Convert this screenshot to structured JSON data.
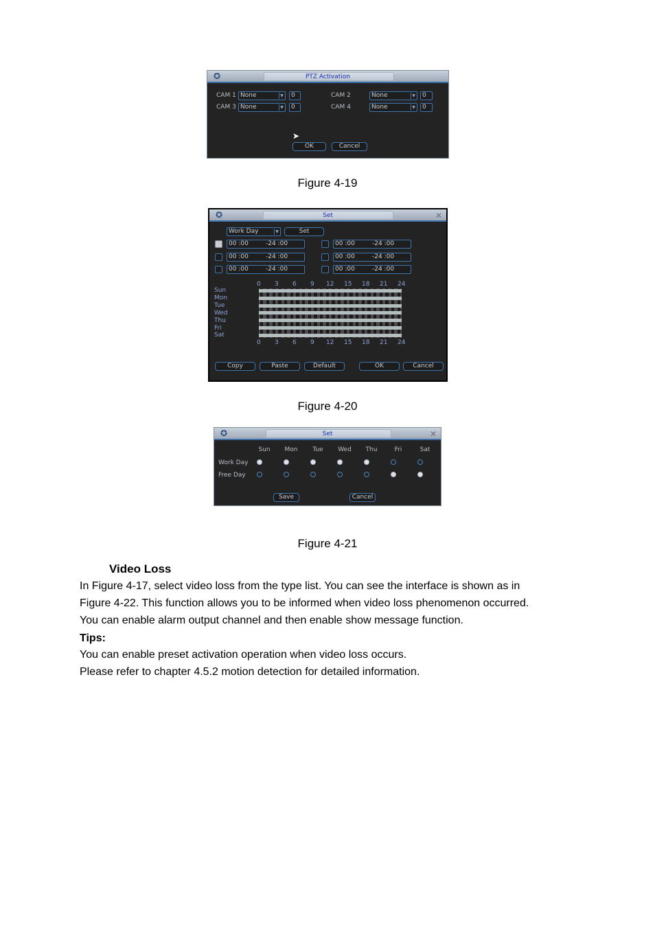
{
  "fig19": {
    "title": "PTZ Activation",
    "cams": [
      {
        "label": "CAM 1",
        "type": "None",
        "value": "0"
      },
      {
        "label": "CAM 2",
        "type": "None",
        "value": "0"
      },
      {
        "label": "CAM 3",
        "type": "None",
        "value": "0"
      },
      {
        "label": "CAM 4",
        "type": "None",
        "value": "0"
      }
    ],
    "ok": "OK",
    "cancel": "Cancel",
    "caption": "Figure 4-19"
  },
  "fig20": {
    "title": "Set",
    "day_type": "Work Day",
    "set_btn": "Set",
    "periods": [
      {
        "start": "00 :00",
        "end": "-24 :00",
        "checked": true
      },
      {
        "start": "00 :00",
        "end": "-24 :00",
        "checked": false
      },
      {
        "start": "00 :00",
        "end": "-24 :00",
        "checked": false
      },
      {
        "start": "00 :00",
        "end": "-24 :00",
        "checked": false
      },
      {
        "start": "00 :00",
        "end": "-24 :00",
        "checked": false
      },
      {
        "start": "00 :00",
        "end": "-24 :00",
        "checked": false
      }
    ],
    "hours": [
      "0",
      "3",
      "6",
      "9",
      "12",
      "15",
      "18",
      "21",
      "24"
    ],
    "days": [
      "Sun",
      "Mon",
      "Tue",
      "Wed",
      "Thu",
      "Fri",
      "Sat"
    ],
    "buttons": {
      "copy": "Copy",
      "paste": "Paste",
      "default": "Default",
      "ok": "OK",
      "cancel": "Cancel"
    },
    "caption": "Figure 4-20"
  },
  "fig21": {
    "title": "Set",
    "days": [
      "Sun",
      "Mon",
      "Tue",
      "Wed",
      "Thu",
      "Fri",
      "Sat"
    ],
    "rows": [
      {
        "label": "Work Day",
        "selected": [
          true,
          true,
          true,
          true,
          true,
          false,
          false
        ]
      },
      {
        "label": "Free Day",
        "selected": [
          false,
          false,
          false,
          false,
          false,
          true,
          true
        ]
      }
    ],
    "save": "Save",
    "cancel": "Cancel",
    "caption": "Figure 4-21"
  },
  "section": {
    "heading": "Video Loss",
    "para": [
      "In Figure 4-17, select video loss from the type list. You can see the interface is shown as in",
      "Figure 4-22. This function allows you to be informed when video loss phenomenon occurred.",
      "You can enable alarm output channel and then enable show message function."
    ],
    "tips_label": "Tips:",
    "tips": [
      "You can enable preset activation operation when video loss occurs.",
      "Please refer to chapter 4.5.2 motion detection for detailed information."
    ]
  }
}
